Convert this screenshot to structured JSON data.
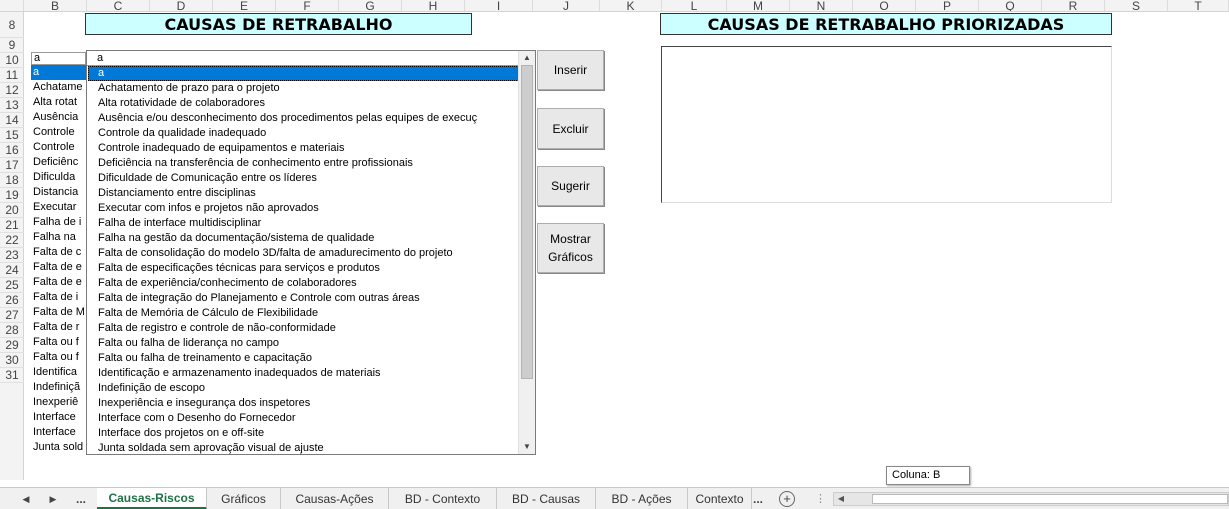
{
  "columns": [
    "B",
    "C",
    "D",
    "E",
    "F",
    "G",
    "H",
    "I",
    "J",
    "K",
    "L",
    "M",
    "N",
    "O",
    "P",
    "Q",
    "R",
    "S",
    "T"
  ],
  "rows": [
    "8",
    "9",
    "10",
    "11",
    "12",
    "13",
    "14",
    "15",
    "16",
    "17",
    "18",
    "19",
    "20",
    "21",
    "22",
    "23",
    "24",
    "25",
    "26",
    "27",
    "28",
    "29",
    "30",
    "31"
  ],
  "titles": {
    "left": "CAUSAS DE RETRABALHO",
    "right": "CAUSAS DE RETRABALHO PRIORIZADAS"
  },
  "column_b": {
    "header": "a",
    "cells": [
      "a",
      "Achatame",
      "Alta rotat",
      "Ausência",
      "Controle",
      "Controle",
      "Deficiênc",
      "Dificulda",
      "Distancia",
      "Executar",
      "Falha de i",
      "Falha na",
      "Falta de c",
      "Falta de e",
      "Falta de e",
      "Falta de i",
      "Falta de M",
      "Falta de r",
      "Falta ou f",
      "Falta ou f",
      "Identifica",
      "Indefiniçã",
      "Inexperiê",
      "Interface",
      "Interface",
      "Junta sold"
    ]
  },
  "listbox": {
    "header": "a",
    "items": [
      "a",
      "Achatamento de prazo para o projeto",
      "Alta rotatividade de colaboradores",
      "Ausência e/ou desconhecimento dos procedimentos pelas equipes de execuç",
      "Controle da qualidade inadequado",
      "Controle inadequado de equipamentos e materiais",
      "Deficiência na transferência de conhecimento entre profissionais",
      "Dificuldade de Comunicação entre os líderes",
      "Distanciamento entre disciplinas",
      "Executar com infos e projetos não aprovados",
      "Falha de interface multidisciplinar",
      "Falha na gestão da documentação/sistema de qualidade",
      "Falta de consolidação do modelo 3D/falta de amadurecimento do projeto",
      "Falta de especificações técnicas para serviços e produtos",
      "Falta de experiência/conhecimento de colaboradores",
      "Falta de integração do Planejamento e Controle com outras áreas",
      "Falta de Memória de Cálculo de Flexibilidade",
      "Falta de registro e controle de não-conformidade",
      "Falta ou falha de liderança no campo",
      "Falta ou falha de treinamento e capacitação",
      "Identificação e armazenamento inadequados de materiais",
      "Indefinição de escopo",
      "Inexperiência e insegurança dos inspetores",
      "Interface com o Desenho do Fornecedor",
      "Interface dos projetos on e off-site",
      "Junta soldada sem aprovação visual de ajuste"
    ]
  },
  "buttons": {
    "inserir": "Inserir",
    "excluir": "Excluir",
    "sugerir": "Sugerir",
    "mostrar_line1": "Mostrar",
    "mostrar_line2": "Gráficos"
  },
  "tooltip": "Coluna: B",
  "sheet_tabs": {
    "ellipsis_left": "...",
    "items": [
      "Causas-Riscos",
      "Gráficos",
      "Causas-Ações",
      "BD - Contexto",
      "BD - Causas",
      "BD - Ações",
      "Contexto"
    ],
    "truncated_suffix": "...",
    "active_index": 0
  },
  "colors": {
    "title_fill": "#ccffff",
    "selection": "#0078d7",
    "active_tab": "#1f7244"
  }
}
